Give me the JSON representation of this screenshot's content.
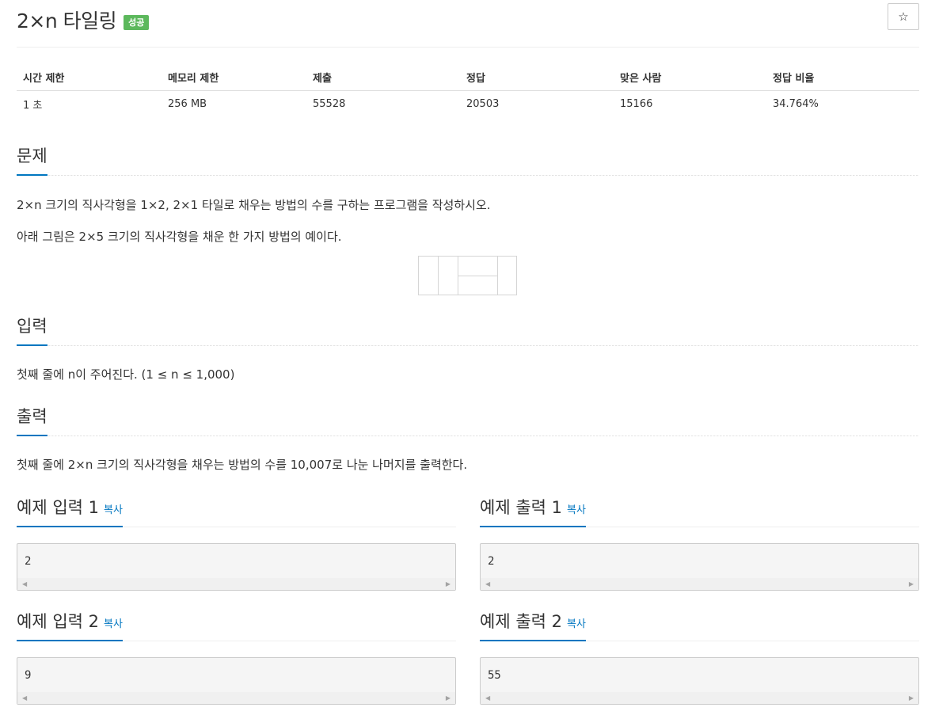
{
  "problem": {
    "title": "2×n 타일링",
    "badge": "성공",
    "star_glyph": "☆"
  },
  "info": {
    "headers": [
      "시간 제한",
      "메모리 제한",
      "제출",
      "정답",
      "맞은 사람",
      "정답 비율"
    ],
    "values": [
      "1 초",
      "256 MB",
      "55528",
      "20503",
      "15166",
      "34.764%"
    ]
  },
  "sections": {
    "problem": {
      "heading": "문제",
      "paragraphs": [
        "2×n 크기의 직사각형을 1×2, 2×1 타일로 채우는 방법의 수를 구하는 프로그램을 작성하시오.",
        "아래 그림은 2×5 크기의 직사각형을 채운 한 가지 방법의 예이다."
      ]
    },
    "input": {
      "heading": "입력",
      "text": "첫째 줄에 n이 주어진다. (1 ≤ n ≤ 1,000)"
    },
    "output": {
      "heading": "출력",
      "text": "첫째 줄에 2×n 크기의 직사각형을 채우는 방법의 수를 10,007로 나눈 나머지를 출력한다."
    }
  },
  "samples": {
    "copy_label": "복사",
    "input1": {
      "title": "예제 입력 1",
      "value": "2"
    },
    "output1": {
      "title": "예제 출력 1",
      "value": "2"
    },
    "input2": {
      "title": "예제 입력 2",
      "value": "9"
    },
    "output2": {
      "title": "예제 출력 2",
      "value": "55"
    }
  },
  "colors": {
    "accent": "#0076c0",
    "badge": "#5cb85c"
  }
}
